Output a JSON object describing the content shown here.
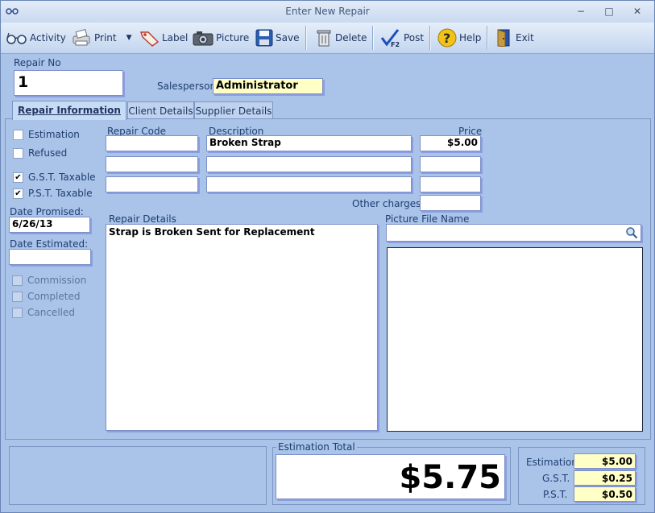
{
  "window": {
    "title": "Enter New Repair",
    "minimize": "−",
    "maximize": "□",
    "close": "✕"
  },
  "toolbar": {
    "activity": "Activity",
    "print": "Print",
    "label": "Label",
    "picture": "Picture",
    "save": "Save",
    "delete": "Delete",
    "post": "Post",
    "help": "Help",
    "exit": "Exit"
  },
  "repair_no": {
    "label": "Repair No",
    "value": "1"
  },
  "salesperson": {
    "label": "Salesperson:",
    "value": "Administrator"
  },
  "tabs": [
    {
      "label": "Repair Information"
    },
    {
      "label": "Client Details"
    },
    {
      "label": "Supplier Details"
    }
  ],
  "options": {
    "estimation": "Estimation",
    "refused": "Refused",
    "gst_taxable": "G.S.T. Taxable",
    "pst_taxable": "P.S.T. Taxable",
    "commission": "Commission",
    "completed": "Completed",
    "cancelled": "Cancelled",
    "checkmark": "✔"
  },
  "dates": {
    "promised_label": "Date Promised:",
    "promised_value": "6/26/13",
    "estimated_label": "Date Estimated:",
    "estimated_value": ""
  },
  "items": {
    "code_header": "Repair Code",
    "desc_header": "Description",
    "price_header": "Price",
    "rows": [
      {
        "code": "",
        "description": "Broken Strap",
        "price": "$5.00"
      },
      {
        "code": "",
        "description": "",
        "price": ""
      },
      {
        "code": "",
        "description": "",
        "price": ""
      }
    ],
    "other_charges_label": "Other charges:",
    "other_charges_value": ""
  },
  "repair_details": {
    "label": "Repair Details",
    "value": "Strap is Broken Sent for Replacement"
  },
  "picture": {
    "label": "Picture File Name",
    "value": ""
  },
  "totals": {
    "estimation_total_label": "Estimation  Total",
    "estimation_total_value": "$5.75",
    "estimation_label": "Estimation",
    "estimation_value": "$5.00",
    "gst_label": "G.S.T.",
    "gst_value": "$0.25",
    "pst_label": "P.S.T.",
    "pst_value": "$0.50"
  }
}
